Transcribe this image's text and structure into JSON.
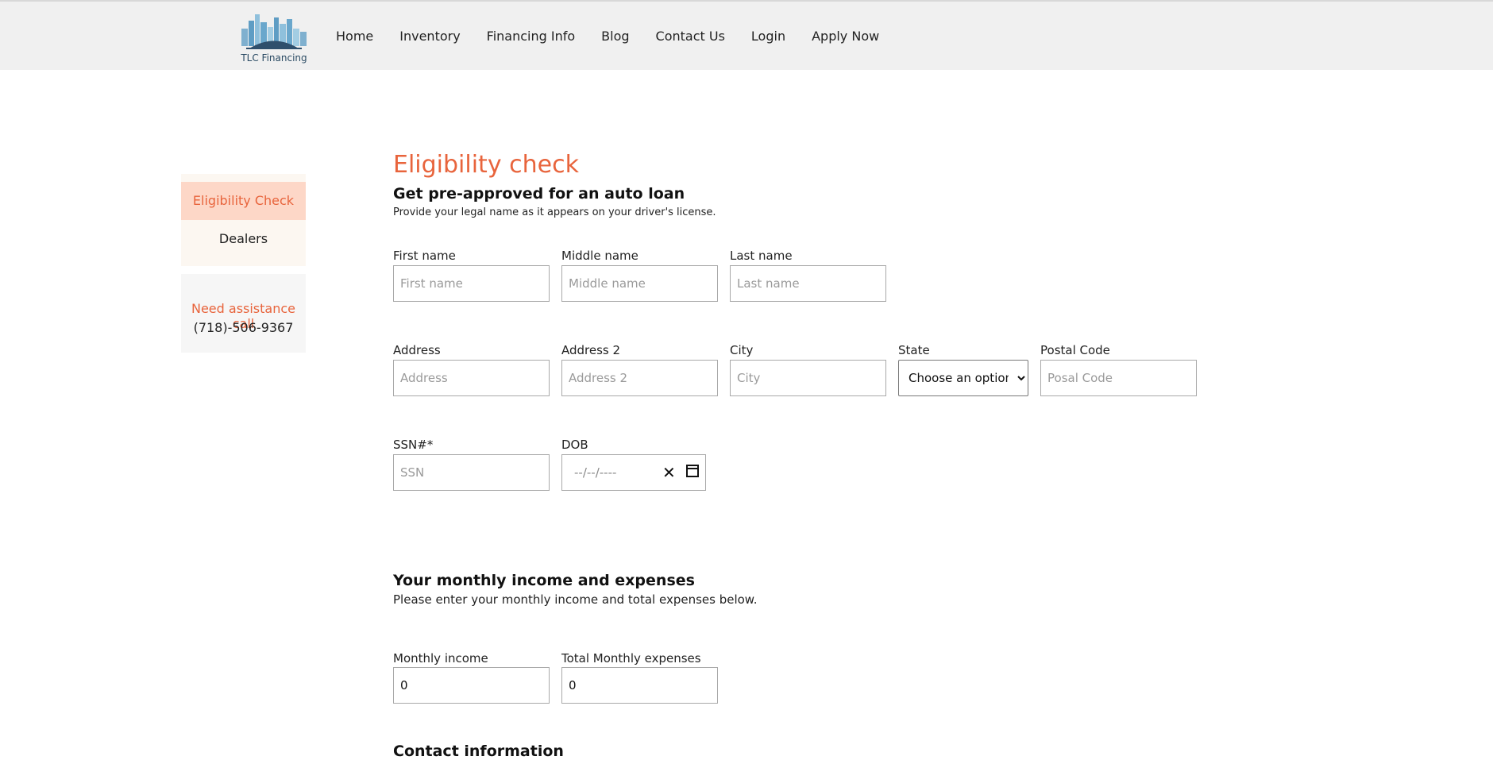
{
  "brand": {
    "name": "TLC Financing"
  },
  "nav": {
    "items": [
      "Home",
      "Inventory",
      "Financing Info",
      "Blog",
      "Contact Us",
      "Login",
      "Apply Now"
    ]
  },
  "sidebar": {
    "items": [
      {
        "label": "Eligibility Check",
        "active": true
      },
      {
        "label": "Dealers",
        "active": false
      }
    ],
    "assist_label": "Need assistance call",
    "assist_phone": "(718)-506-9367"
  },
  "form": {
    "title": "Eligibility check",
    "subtitle_prefix": "Get ",
    "subtitle_bold": "pre-approved",
    "subtitle_suffix": " for an auto loan",
    "note": "Provide your legal name as it appears on your driver's license.",
    "first_name": {
      "label": "First name",
      "placeholder": "First name"
    },
    "middle_name": {
      "label": "Middle name",
      "placeholder": "Middle name"
    },
    "last_name": {
      "label": "Last name",
      "placeholder": "Last name"
    },
    "address": {
      "label": "Address",
      "placeholder": "Address"
    },
    "address2": {
      "label": "Address 2",
      "placeholder": "Address 2"
    },
    "city": {
      "label": "City",
      "placeholder": "City"
    },
    "state": {
      "label": "State",
      "value": "Choose an option"
    },
    "postal": {
      "label": "Postal Code",
      "placeholder": "Posal Code"
    },
    "ssn": {
      "label": "SSN#*",
      "placeholder": "SSN"
    },
    "dob": {
      "label": "DOB",
      "placeholder": "--/--/----"
    }
  },
  "income": {
    "heading": "Your monthly income and expenses",
    "note": "Please enter your monthly income and total expenses below.",
    "monthly_income": {
      "label": "Monthly income",
      "value": "0"
    },
    "monthly_expenses": {
      "label": "Total Monthly expenses",
      "value": "0"
    }
  },
  "contact": {
    "heading": "Contact information"
  },
  "colors": {
    "accent": "#e8643c",
    "active_bg": "#fdd7c7",
    "header_bg": "#f0f0f0"
  },
  "icons": {
    "clear": "close-icon",
    "calendar": "calendar-icon"
  }
}
